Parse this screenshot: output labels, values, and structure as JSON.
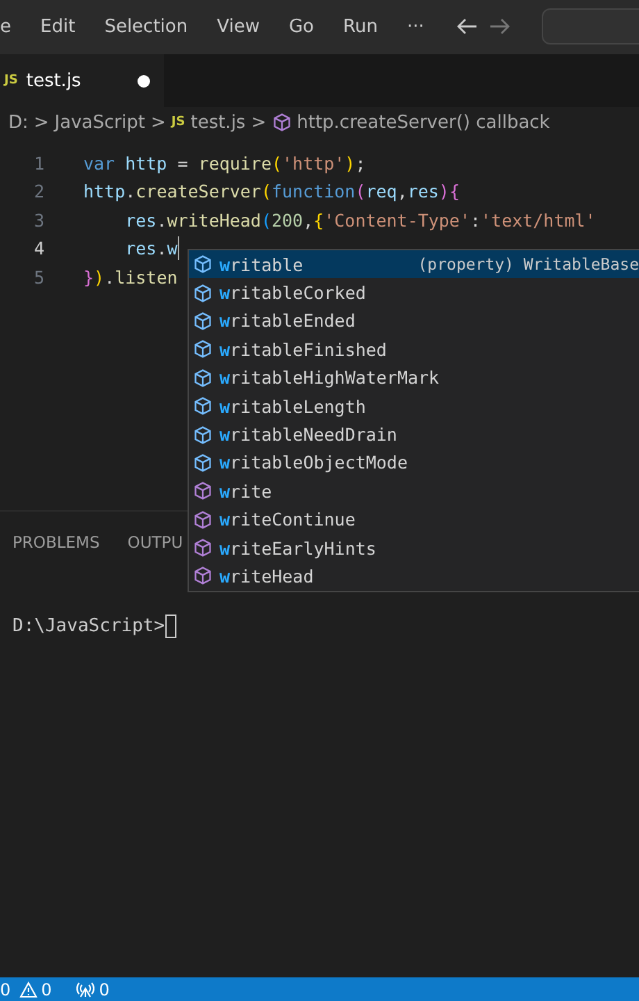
{
  "menu": [
    {
      "label": "e"
    },
    {
      "label": "Edit"
    },
    {
      "label": "Selection"
    },
    {
      "label": "View"
    },
    {
      "label": "Go"
    },
    {
      "label": "Run"
    },
    {
      "label": "···"
    }
  ],
  "tabs": [
    {
      "icon": "JS",
      "label": "test.js",
      "selected": true,
      "dirty": true
    }
  ],
  "breadcrumb": [
    {
      "label": "D:",
      "kind": "folder"
    },
    {
      "label": "JavaScript",
      "kind": "folder"
    },
    {
      "label": "test.js",
      "kind": "file",
      "icon": "JS"
    },
    {
      "label": "http.createServer() callback",
      "kind": "symbol"
    }
  ],
  "separator": ">",
  "code": [
    {
      "number": "1",
      "active": false,
      "tokens": [
        {
          "text": "var ",
          "kind": "keyword"
        },
        {
          "text": "http",
          "kind": "variable"
        },
        {
          "text": " = ",
          "kind": "plain"
        },
        {
          "text": "require",
          "kind": "function"
        },
        {
          "text": "(",
          "kind": "bracket"
        },
        {
          "text": "'http'",
          "kind": "string"
        },
        {
          "text": ")",
          "kind": "bracket"
        },
        {
          "text": ";",
          "kind": "plain"
        }
      ]
    },
    {
      "number": "2",
      "active": false,
      "tokens": [
        {
          "text": "http",
          "kind": "variable"
        },
        {
          "text": ".",
          "kind": "plain"
        },
        {
          "text": "createServer",
          "kind": "function"
        },
        {
          "text": "(",
          "kind": "bracket"
        },
        {
          "text": "function",
          "kind": "keyword"
        },
        {
          "text": "(",
          "kind": "bracket2"
        },
        {
          "text": "req",
          "kind": "variable"
        },
        {
          "text": ",",
          "kind": "plain"
        },
        {
          "text": "res",
          "kind": "variable"
        },
        {
          "text": ")",
          "kind": "bracket2"
        },
        {
          "text": "{",
          "kind": "bracket2"
        }
      ]
    },
    {
      "number": "3",
      "active": false,
      "tokens": [
        {
          "text": "    res",
          "kind": "variable"
        },
        {
          "text": ".",
          "kind": "plain"
        },
        {
          "text": "writeHead",
          "kind": "function"
        },
        {
          "text": "(",
          "kind": "bracket3"
        },
        {
          "text": "200",
          "kind": "number"
        },
        {
          "text": ",",
          "kind": "plain"
        },
        {
          "text": "{",
          "kind": "bracket"
        },
        {
          "text": "'Content-Type'",
          "kind": "string"
        },
        {
          "text": ":",
          "kind": "plain"
        },
        {
          "text": "'text/html'",
          "kind": "string"
        }
      ]
    },
    {
      "number": "4",
      "active": true,
      "tokens": [
        {
          "text": "    res",
          "kind": "variable"
        },
        {
          "text": ".",
          "kind": "plain"
        },
        {
          "text": "w",
          "kind": "variable"
        }
      ]
    },
    {
      "number": "5",
      "active": false,
      "tokens": [
        {
          "text": "}",
          "kind": "bracket2"
        },
        {
          "text": ")",
          "kind": "bracket"
        },
        {
          "text": ".",
          "kind": "plain"
        },
        {
          "text": "listen",
          "kind": "function"
        }
      ]
    }
  ],
  "suggestions": [
    {
      "match": "w",
      "rest": "ritable",
      "kind": "property",
      "selected": true,
      "detail": "(property) WritableBase"
    },
    {
      "match": "w",
      "rest": "ritableCorked",
      "kind": "property",
      "selected": false
    },
    {
      "match": "w",
      "rest": "ritableEnded",
      "kind": "property",
      "selected": false
    },
    {
      "match": "w",
      "rest": "ritableFinished",
      "kind": "property",
      "selected": false
    },
    {
      "match": "w",
      "rest": "ritableHighWaterMark",
      "kind": "property",
      "selected": false
    },
    {
      "match": "w",
      "rest": "ritableLength",
      "kind": "property",
      "selected": false
    },
    {
      "match": "w",
      "rest": "ritableNeedDrain",
      "kind": "property",
      "selected": false
    },
    {
      "match": "w",
      "rest": "ritableObjectMode",
      "kind": "property",
      "selected": false
    },
    {
      "match": "w",
      "rest": "rite",
      "kind": "method",
      "selected": false
    },
    {
      "match": "w",
      "rest": "riteContinue",
      "kind": "method",
      "selected": false
    },
    {
      "match": "w",
      "rest": "riteEarlyHints",
      "kind": "method",
      "selected": false
    },
    {
      "match": "w",
      "rest": "riteHead",
      "kind": "method",
      "selected": false
    }
  ],
  "panel_tabs": [
    {
      "label": "PROBLEMS",
      "selected": false
    },
    {
      "label": "OUTPU",
      "selected": false
    }
  ],
  "terminal": {
    "prompt": "D:\\JavaScript>"
  },
  "status_bar": [
    {
      "kind": "errors",
      "text": "0"
    },
    {
      "kind": "warnings",
      "text": "0"
    },
    {
      "kind": "ports",
      "text": "0"
    }
  ]
}
